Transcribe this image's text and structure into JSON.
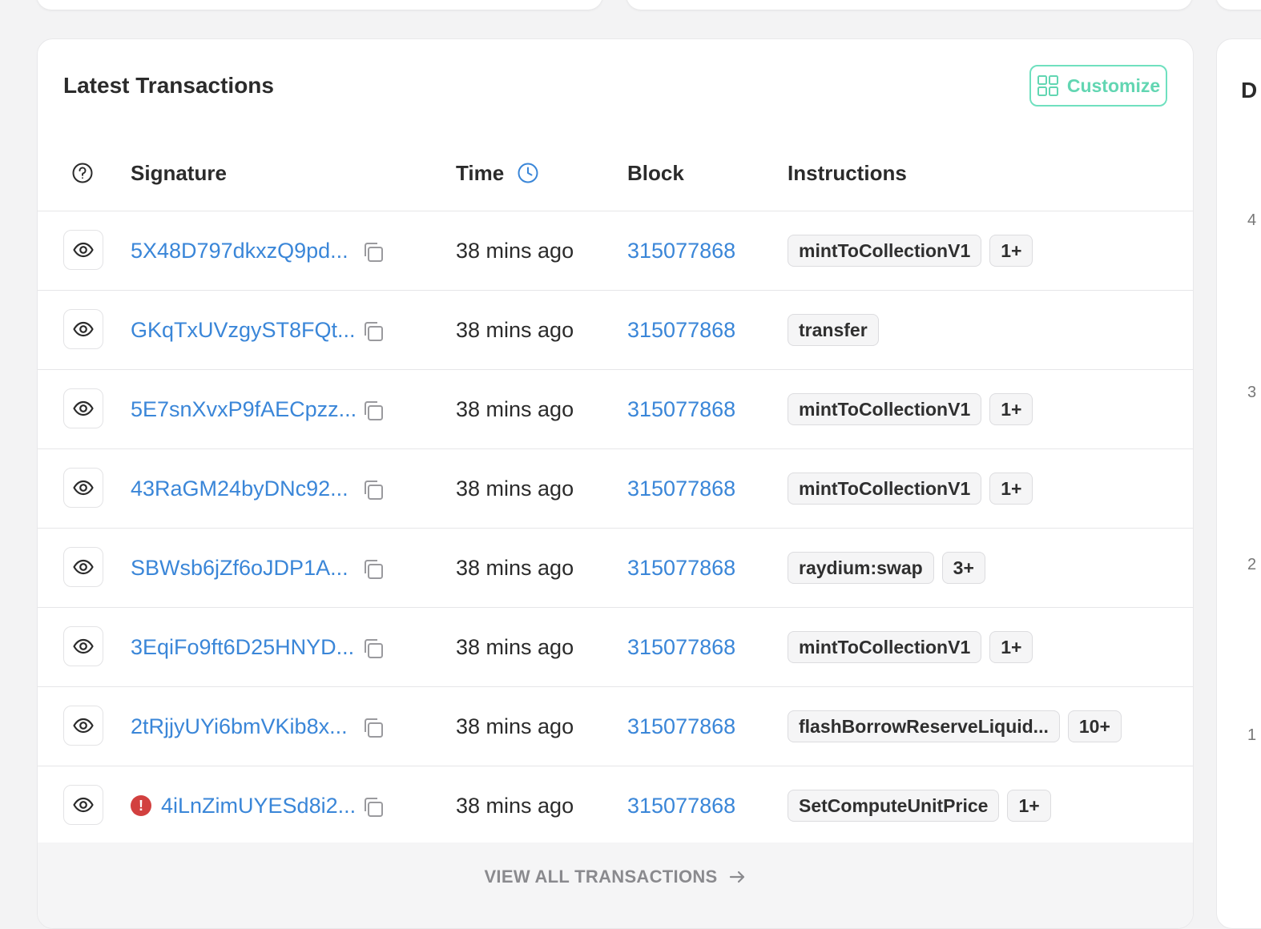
{
  "card": {
    "title": "Latest Transactions",
    "customize_label": "Customize"
  },
  "table": {
    "columns": {
      "help_icon": "question-circle-icon",
      "signature": "Signature",
      "time": "Time",
      "block": "Block",
      "instructions": "Instructions"
    },
    "rows": [
      {
        "signature": "5X48D797dkxzQ9pd...",
        "time": "38 mins ago",
        "block": "315077868",
        "instructions": [
          "mintToCollectionV1",
          "1+"
        ],
        "error": false
      },
      {
        "signature": "GKqTxUVzgyST8FQt...",
        "time": "38 mins ago",
        "block": "315077868",
        "instructions": [
          "transfer"
        ],
        "error": false
      },
      {
        "signature": "5E7snXvxP9fAECpzz...",
        "time": "38 mins ago",
        "block": "315077868",
        "instructions": [
          "mintToCollectionV1",
          "1+"
        ],
        "error": false
      },
      {
        "signature": "43RaGM24byDNc92...",
        "time": "38 mins ago",
        "block": "315077868",
        "instructions": [
          "mintToCollectionV1",
          "1+"
        ],
        "error": false
      },
      {
        "signature": "SBWsb6jZf6oJDP1A...",
        "time": "38 mins ago",
        "block": "315077868",
        "instructions": [
          "raydium:swap",
          "3+"
        ],
        "error": false
      },
      {
        "signature": "3EqiFo9ft6D25HNYD...",
        "time": "38 mins ago",
        "block": "315077868",
        "instructions": [
          "mintToCollectionV1",
          "1+"
        ],
        "error": false
      },
      {
        "signature": "2tRjjyUYi6bmVKib8x...",
        "time": "38 mins ago",
        "block": "315077868",
        "instructions": [
          "flashBorrowReserveLiquid...",
          "10+"
        ],
        "error": false
      },
      {
        "signature": "4iLnZimUYESd8i2...",
        "time": "38 mins ago",
        "block": "315077868",
        "instructions": [
          "SetComputeUnitPrice",
          "1+"
        ],
        "error": true
      }
    ]
  },
  "footer": {
    "view_all_label": "VIEW ALL TRANSACTIONS"
  },
  "side_panel": {
    "title_fragment": "D",
    "ticks": [
      "4",
      "3",
      "2",
      "1"
    ]
  },
  "colors": {
    "link": "#3a86d8",
    "accent": "#62d6b2",
    "error": "#d2403f"
  }
}
